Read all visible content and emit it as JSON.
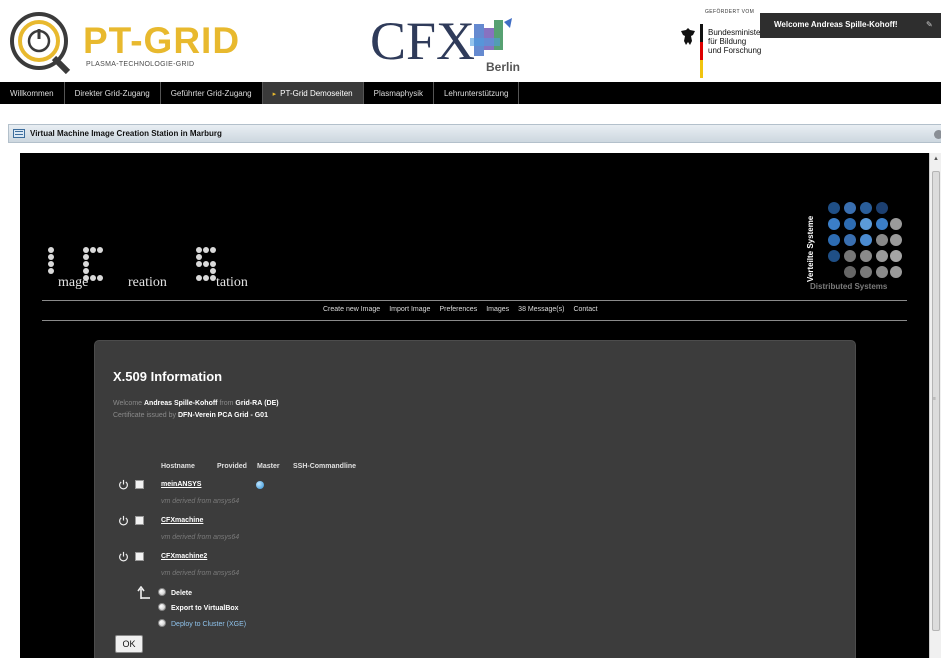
{
  "header": {
    "portal_title": "PT-GRID",
    "portal_subtitle": "PLASMA-TECHNOLOGIE-GRID",
    "partner_logo_text": "CFX",
    "partner_logo_sub": "Berlin",
    "funding_label": "GEFÖRDERT VOM",
    "ministry_line1": "Bundesministerium",
    "ministry_line2": "für Bildung",
    "ministry_line3": "und Forschung",
    "welcome": "Welcome Andreas Spille-Kohoff!",
    "brand_color": "#e8b92e"
  },
  "topnav": {
    "items": [
      {
        "label": "Willkommen"
      },
      {
        "label": "Direkter Grid-Zugang"
      },
      {
        "label": "Geführter Grid-Zugang"
      },
      {
        "label": "PT-Grid Demoseiten",
        "active": true
      },
      {
        "label": "Plasmaphysik"
      },
      {
        "label": "Lehrunterstützung"
      }
    ]
  },
  "portlet": {
    "title": "Virtual Machine Image Creation Station in Marburg"
  },
  "ics": {
    "word1": "mage",
    "word2": "reation",
    "word3": "tation",
    "brand_vertical": "Verteilte Systeme",
    "brand_sub": "Distributed Systems",
    "nav": [
      "Create new Image",
      "Import Image",
      "Preferences",
      "Images",
      "38 Message(s)",
      "Contact"
    ]
  },
  "panel": {
    "title": "X.509 Information",
    "welcome_prefix": "Welcome",
    "user_name": "Andreas Spille-Kohoff",
    "from_word": "from",
    "ra": "Grid-RA",
    "country": "(DE)",
    "cert_prefix": "Certificate issued by",
    "issuer": "DFN-Verein PCA Grid - G01",
    "columns": [
      "Hostname",
      "Provided",
      "Master",
      "SSH-Commandline"
    ],
    "machines": [
      {
        "hostname": "meinANSYS",
        "derived": "vm derived from ansys64",
        "master": true
      },
      {
        "hostname": "CFXmachine",
        "derived": "vm derived from ansys64",
        "master": false
      },
      {
        "hostname": "CFXmachine2",
        "derived": "vm derived from ansys64",
        "master": false
      }
    ],
    "actions": [
      "Delete",
      "Export to VirtualBox",
      "Deploy to Cluster (XGE)"
    ],
    "ok_label": "OK"
  }
}
